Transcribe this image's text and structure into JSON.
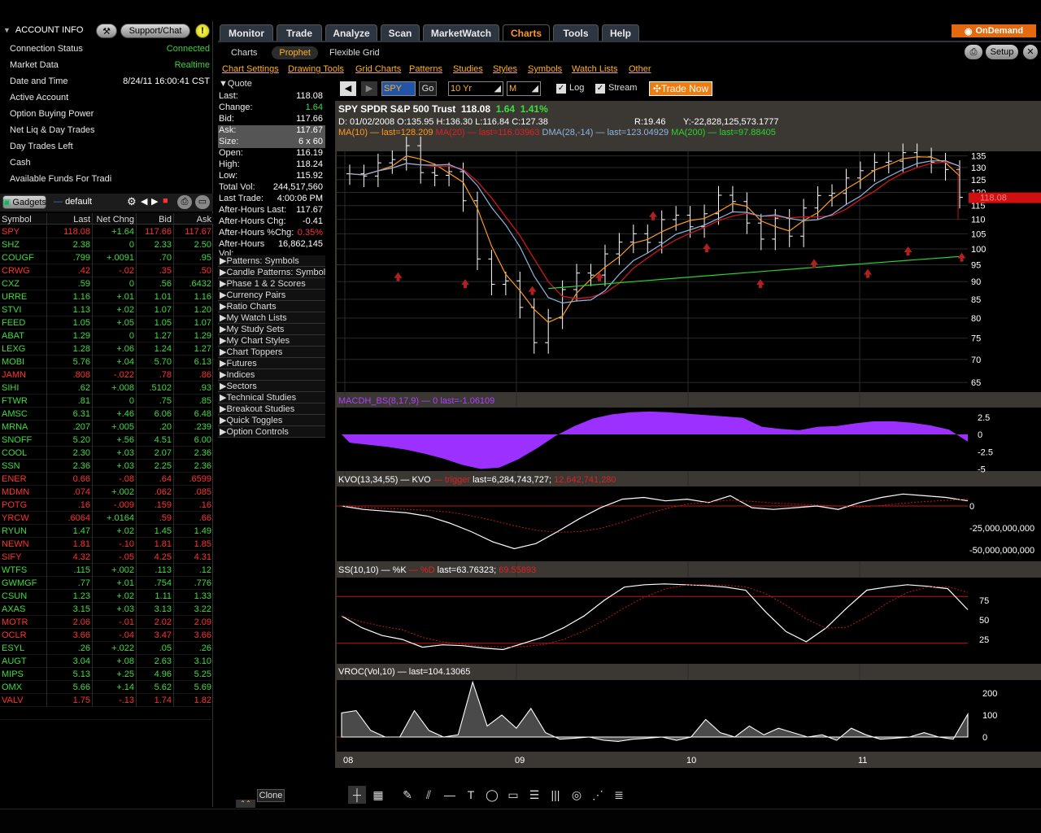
{
  "account": {
    "title": "ACCOUNT INFO",
    "support_label": "Support/Chat",
    "rows": [
      {
        "label": "Connection Status",
        "value": "Connected"
      },
      {
        "label": "Market Data",
        "value": "Realtime"
      },
      {
        "label": "Date and Time",
        "value": "8/24/11 16:00:41 CST"
      },
      {
        "label": "Active Account",
        "value": ""
      },
      {
        "label": "Option Buying Power",
        "value": ""
      },
      {
        "label": "Net Liq & Day Trades",
        "value": ""
      },
      {
        "label": "Day Trades Left",
        "value": ""
      },
      {
        "label": "Cash",
        "value": ""
      },
      {
        "label": "Available Funds For Tradi",
        "value": ""
      }
    ]
  },
  "gadgets": {
    "label": "Gadgets",
    "watchlist_name": "default"
  },
  "watchlist": {
    "columns": [
      "Symbol",
      "Last",
      "Net Chng",
      "Bid",
      "Ask"
    ],
    "rows": [
      [
        "SPY",
        "118.08",
        "+1.64",
        "117.66",
        "117.67",
        "r"
      ],
      [
        "SHZ",
        "2.38",
        "0",
        "2.33",
        "2.50",
        "g"
      ],
      [
        "COUGF",
        ".799",
        "+.0091",
        ".70",
        ".95",
        "g"
      ],
      [
        "CRWG",
        ".42",
        "-.02",
        ".35",
        ".50",
        "r"
      ],
      [
        "CXZ",
        ".59",
        "0",
        ".56",
        ".6432",
        "g"
      ],
      [
        "URRE",
        "1.16",
        "+.01",
        "1.01",
        "1.16",
        "g"
      ],
      [
        "STVI",
        "1.13",
        "+.02",
        "1.07",
        "1.20",
        "g"
      ],
      [
        "FEED",
        "1.05",
        "+.05",
        "1.05",
        "1.07",
        "g"
      ],
      [
        "ABAT",
        "1.29",
        "0",
        "1.27",
        "1.29",
        "g"
      ],
      [
        "LEXG",
        "1.28",
        "+.06",
        "1.24",
        "1.27",
        "g"
      ],
      [
        "MOBI",
        "5.76",
        "+.04",
        "5.70",
        "6.13",
        "g"
      ],
      [
        "JAMN",
        ".808",
        "-.022",
        ".78",
        ".86",
        "r"
      ],
      [
        "SIHI",
        ".62",
        "+.008",
        ".5102",
        ".93",
        "g"
      ],
      [
        "FTWR",
        ".81",
        "0",
        ".75",
        ".85",
        "g"
      ],
      [
        "AMSC",
        "6.31",
        "+.46",
        "6.06",
        "6.48",
        "g"
      ],
      [
        "MRNA",
        ".207",
        "+.005",
        ".20",
        ".239",
        "g"
      ],
      [
        "SNOFF",
        "5.20",
        "+.56",
        "4.51",
        "6.00",
        "g"
      ],
      [
        "COOL",
        "2.30",
        "+.03",
        "2.07",
        "2.36",
        "g"
      ],
      [
        "SSN",
        "2.36",
        "+.03",
        "2.25",
        "2.36",
        "g"
      ],
      [
        "ENER",
        "0.66",
        "-.08",
        ".64",
        ".6599",
        "r"
      ],
      [
        "MDMN",
        ".074",
        "+.002",
        ".062",
        ".085",
        "r"
      ],
      [
        "POTG",
        ".16",
        "-.009",
        ".159",
        ".16",
        "r"
      ],
      [
        "YRCW",
        ".6064",
        "+.0164",
        ".59",
        ".66",
        "r"
      ],
      [
        "RYUN",
        "1.47",
        "+.02",
        "1.45",
        "1.49",
        "g"
      ],
      [
        "NEWN",
        "1.81",
        "-.10",
        "1.81",
        "1.85",
        "r"
      ],
      [
        "SIFY",
        "4.32",
        "-.05",
        "4.25",
        "4.31",
        "r"
      ],
      [
        "WTFS",
        ".115",
        "+.002",
        ".113",
        ".12",
        "g"
      ],
      [
        "GWMGF",
        ".77",
        "+.01",
        ".754",
        ".776",
        "g"
      ],
      [
        "CSUN",
        "1.23",
        "+.02",
        "1.11",
        "1.33",
        "g"
      ],
      [
        "AXAS",
        "3.15",
        "+.03",
        "3.13",
        "3.22",
        "g"
      ],
      [
        "MOTR",
        "2.06",
        "-.01",
        "2.02",
        "2.09",
        "r"
      ],
      [
        "OCLR",
        "3.66",
        "-.04",
        "3.47",
        "3.66",
        "r"
      ],
      [
        "ESYL",
        ".26",
        "+.022",
        ".05",
        ".26",
        "g"
      ],
      [
        "AUGT",
        "3.04",
        "+.08",
        "2.63",
        "3.10",
        "g"
      ],
      [
        "MIPS",
        "5.13",
        "+.25",
        "4.96",
        "5.25",
        "g"
      ],
      [
        "OMX",
        "5.66",
        "+.14",
        "5.62",
        "5.69",
        "g"
      ],
      [
        "VALV",
        "1.75",
        "-.13",
        "1.74",
        "1.82",
        "r"
      ]
    ]
  },
  "quote": {
    "title": "Quote",
    "rows": [
      [
        "Last:",
        "118.08"
      ],
      [
        "Change:",
        "1.64"
      ],
      [
        "Bid:",
        "117.66"
      ],
      [
        "Ask:",
        "117.67"
      ],
      [
        "Size:",
        "6 x 60"
      ],
      [
        "Open:",
        "116.19"
      ],
      [
        "High:",
        "118.24"
      ],
      [
        "Low:",
        "115.92"
      ],
      [
        "Total Vol:",
        "244,517,560"
      ],
      [
        "Last Trade:",
        "4:00:06 PM"
      ],
      [
        "After-Hours Last:",
        "117.67"
      ],
      [
        "After-Hours Chg:",
        "-0.41"
      ],
      [
        "After-Hours %Chg:",
        "0.35%"
      ],
      [
        "After-Hours Vol:",
        "16,862,145"
      ]
    ],
    "sections": [
      "Patterns: Symbols",
      "Candle Patterns: Symbols",
      "Phase 1 & 2 Scores",
      "Currency Pairs",
      "Ratio Charts",
      "My Watch Lists",
      "My Study Sets",
      "My Chart Styles",
      "Chart Toppers",
      "Futures",
      "Indices",
      "Sectors",
      "Technical Studies",
      "Breakout Studies",
      "Quick Toggles",
      "Option Controls"
    ],
    "clone_label": "Clone"
  },
  "tabs": [
    "Monitor",
    "Trade",
    "Analyze",
    "Scan",
    "MarketWatch",
    "Charts",
    "Tools",
    "Help"
  ],
  "active_tab": "Charts",
  "ondemand": "OnDemand",
  "setup": "Setup",
  "subtabs": [
    "Charts",
    "Prophet",
    "Flexible Grid"
  ],
  "menus": [
    "Chart Settings",
    "Drawing Tools",
    "Grid Charts",
    "Patterns",
    "Studies",
    "Styles",
    "Symbols",
    "Watch Lists",
    "Other"
  ],
  "toolbar": {
    "symbol": "SPY",
    "go": "Go",
    "period": "10 Yr",
    "agg": "M",
    "log": "Log",
    "stream": "Stream",
    "trade_now": "Trade Now"
  },
  "chart": {
    "title": "SPY SPDR S&P 500 Trust",
    "price": "118.08",
    "change": "1.64",
    "pct": "1.41%",
    "ohlc": "D: 01/02/2008 O:135.95 H:136.30 L:116.84 C:127.38",
    "r": "R:19.46",
    "y": "Y:-22,828,125,573.1777",
    "ma_line": [
      {
        "t": "MA(10) — last=128.209 ",
        "c": "#ff9a1a"
      },
      {
        "t": "MA(20) — last=116.03963 ",
        "c": "#e02020"
      },
      {
        "t": "DMA(28,-14) — last=123.04929 ",
        "c": "#8fb4e0"
      },
      {
        "t": "MA(200) — last=97.88405",
        "c": "#2ed12e"
      }
    ],
    "price_label": "118.08",
    "y_ticks": [
      "135",
      "130",
      "125",
      "120",
      "115",
      "110",
      "105",
      "100",
      "95",
      "90",
      "85",
      "80",
      "75",
      "70",
      "65"
    ],
    "x_labels": [
      "08",
      "09",
      "10",
      "11"
    ],
    "macd_label": "MACDH_BS(8,17,9) — 0 last=-1.06109",
    "macd_ticks": [
      "2.5",
      "0",
      "-2.5",
      "-5"
    ],
    "kvo_label": [
      "KVO(13,34,55) — KVO ",
      "— trigger ",
      "last=6,284,743,727; ",
      "12,642,741,280"
    ],
    "kvo_ticks": [
      "0",
      "-25,000,000,000",
      "-50,000,000,000"
    ],
    "ss_label": [
      "SS(10,10) — %K ",
      "— %D ",
      "last=63.76323; ",
      "69.55893"
    ],
    "ss_ticks": [
      "75",
      "50",
      "25"
    ],
    "vroc_label": "VROC(Vol,10) — last=104.13065",
    "vroc_ticks": [
      "200",
      "100",
      "0"
    ]
  },
  "chart_data": {
    "type": "candlestick-monthly",
    "symbol": "SPY",
    "x_axis_labels": [
      "08",
      "09",
      "10",
      "11"
    ],
    "ylim": [
      63,
      137
    ],
    "close": [
      127.4,
      126.5,
      132,
      133.4,
      139.5,
      127.9,
      126.8,
      128.3,
      116.8,
      96.8,
      89.2,
      90.2,
      82.8,
      73.9,
      80,
      87.7,
      92.5,
      91.9,
      98.4,
      102.2,
      105,
      102.1,
      109.9,
      111.5,
      107.4,
      112,
      118.9,
      116.5,
      108.7,
      103.2,
      110.4,
      104.2,
      114.1,
      118.8,
      119.6,
      125.7,
      128.7,
      132.2,
      132.7,
      136.4,
      134.6,
      132.3,
      129.2,
      118.08
    ]
  }
}
